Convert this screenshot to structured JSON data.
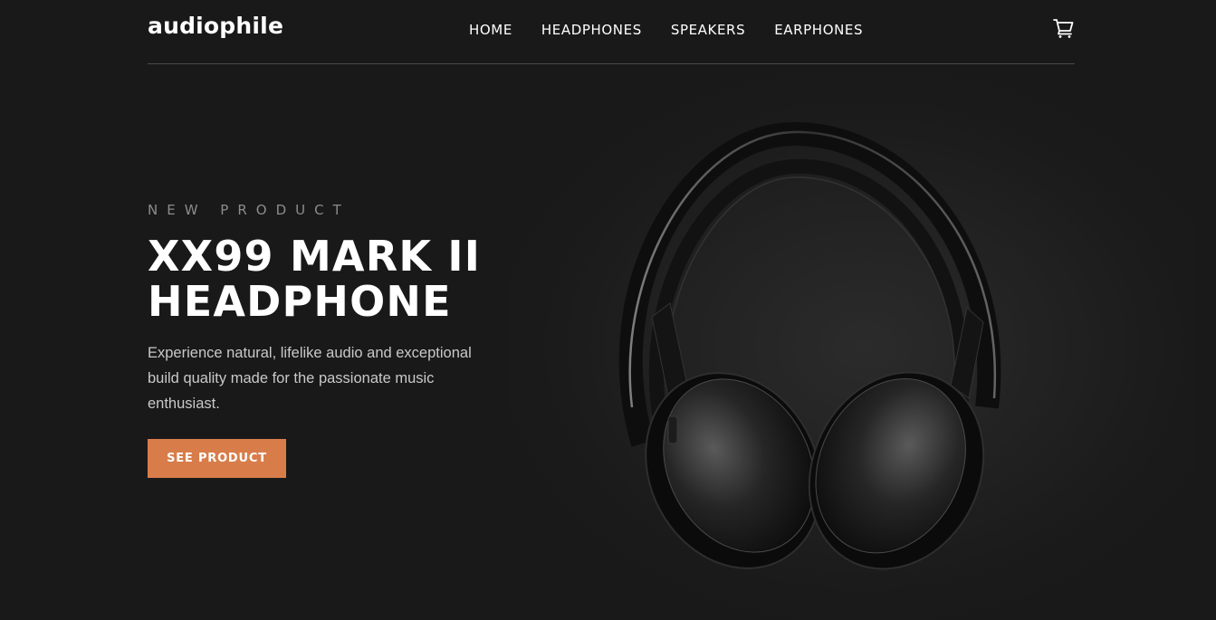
{
  "header": {
    "logo": "audiophile",
    "nav": [
      {
        "label": "HOME"
      },
      {
        "label": "HEADPHONES"
      },
      {
        "label": "SPEAKERS"
      },
      {
        "label": "EARPHONES"
      }
    ],
    "cart_icon": "shopping-cart-icon"
  },
  "hero": {
    "overline": "NEW PRODUCT",
    "title_line1": "XX99 MARK II",
    "title_line2": "HEADPHONE",
    "description": "Experience natural, lifelike audio and exceptional build quality made for the passionate music enthusiast.",
    "cta_label": "SEE PRODUCT",
    "image_icon": "headphones-image"
  },
  "colors": {
    "background": "#191919",
    "accent": "#d87d4a",
    "text": "#ffffff",
    "muted": "#8c8c8c"
  }
}
